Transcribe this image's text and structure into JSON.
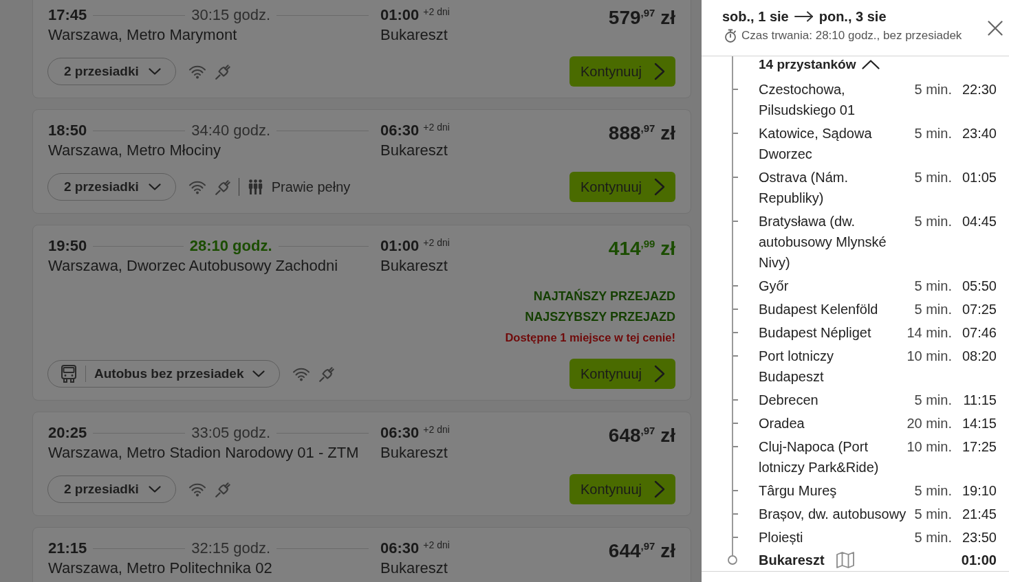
{
  "trips": [
    {
      "departure_time": "17:45",
      "duration": "30:15 godz.",
      "arrival_time": "01:00",
      "arrival_day_offset": "+2 dni",
      "origin": "Warszawa, Metro Marymont",
      "destination": "Bukareszt",
      "price": "579$^{,97}$ zł",
      "highlighted": false,
      "route_pill": {
        "kind": "transfers",
        "label": "2 przesiadki"
      },
      "button": "Kontynuuj"
    },
    {
      "departure_time": "18:50",
      "duration": "34:40 godz.",
      "arrival_time": "06:30",
      "arrival_day_offset": "+2 dni",
      "origin": "Warszawa, Metro Młociny",
      "destination": "Bukareszt",
      "price": "888$^{,97}$ zł",
      "highlighted": false,
      "route_pill": {
        "kind": "transfers",
        "label": "2 przesiadki"
      },
      "occupancy": "Prawie pełny",
      "button": "Kontynuuj"
    },
    {
      "departure_time": "19:50",
      "duration": "28:10 godz.",
      "arrival_time": "01:00",
      "arrival_day_offset": "+2 dni",
      "origin": "Warszawa, Dworzec Autobusowy Zachodni",
      "destination": "Bukareszt",
      "price": "414$^{,99}$ zł",
      "highlighted": true,
      "badges": [
        "NAJTAŃSZY PRZEJAZD",
        "NAJSZYBSZY PRZEJAZD"
      ],
      "availability_note": "Dostępne 1 miejsce w tej cenie!",
      "route_pill": {
        "kind": "direct",
        "label": "Autobus bez przesiadek"
      },
      "button": "Kontynuuj"
    },
    {
      "departure_time": "20:25",
      "duration": "33:05 godz.",
      "arrival_time": "06:30",
      "arrival_day_offset": "+2 dni",
      "origin": "Warszawa, Metro Stadion Narodowy 01 - ZTM",
      "destination": "Bukareszt",
      "price": "648$^{,97}$ zł",
      "highlighted": false,
      "route_pill": {
        "kind": "transfers",
        "label": "2 przesiadki"
      },
      "button": "Kontynuuj"
    },
    {
      "departure_time": "21:15",
      "duration": "32:15 godz.",
      "arrival_time": "06:30",
      "arrival_day_offset": "+2 dni",
      "origin": "Warszawa, Metro Politechnika 02",
      "destination": "Bukareszt",
      "price": "644$^{,97}$ zł",
      "highlighted": false
    }
  ],
  "details_panel": {
    "departure_date": "sob., 1 sie",
    "arrival_date": "pon., 3 sie",
    "summary": "Czas trwania: 28:10 godz., bez przesiadek",
    "stops_toggle": {
      "label": "14 przystanków",
      "expanded": true
    },
    "stops": [
      {
        "name": "Czestochowa,\nPilsudskiego 01",
        "wait": "5 min.",
        "time": "22:30"
      },
      {
        "name": "Katowice, Sądowa\nDworzec",
        "wait": "5 min.",
        "time": "23:40"
      },
      {
        "name": "Ostrava (Nám.\nRepubliky)",
        "wait": "5 min.",
        "time": "01:05"
      },
      {
        "name": "Bratysława (dw.\nautobusowy Mlynské\nNivy)",
        "wait": "5 min.",
        "time": "04:45"
      },
      {
        "name": "Győr",
        "wait": "5 min.",
        "time": "05:50"
      },
      {
        "name": "Budapest Kelenföld",
        "wait": "5 min.",
        "time": "07:25"
      },
      {
        "name": "Budapest Népliget",
        "wait": "14 min.",
        "time": "07:46"
      },
      {
        "name": "Port lotniczy\nBudapeszt",
        "wait": "10 min.",
        "time": "08:20"
      },
      {
        "name": "Debrecen",
        "wait": "5 min.",
        "time": "11:15"
      },
      {
        "name": "Oradea",
        "wait": "20 min.",
        "time": "14:15"
      },
      {
        "name": "Cluj-Napoca (Port\nlotniczy Park&Ride)",
        "wait": "10 min.",
        "time": "17:25"
      },
      {
        "name": "Târgu Mureş",
        "wait": "5 min.",
        "time": "19:10"
      },
      {
        "name": "Brașov, dw. autobusowy",
        "wait": "5 min.",
        "time": "21:45"
      },
      {
        "name": "Ploiești",
        "wait": "5 min.",
        "time": "23:50"
      }
    ],
    "destination": {
      "name": "Bukareszt",
      "time": "01:00"
    }
  }
}
